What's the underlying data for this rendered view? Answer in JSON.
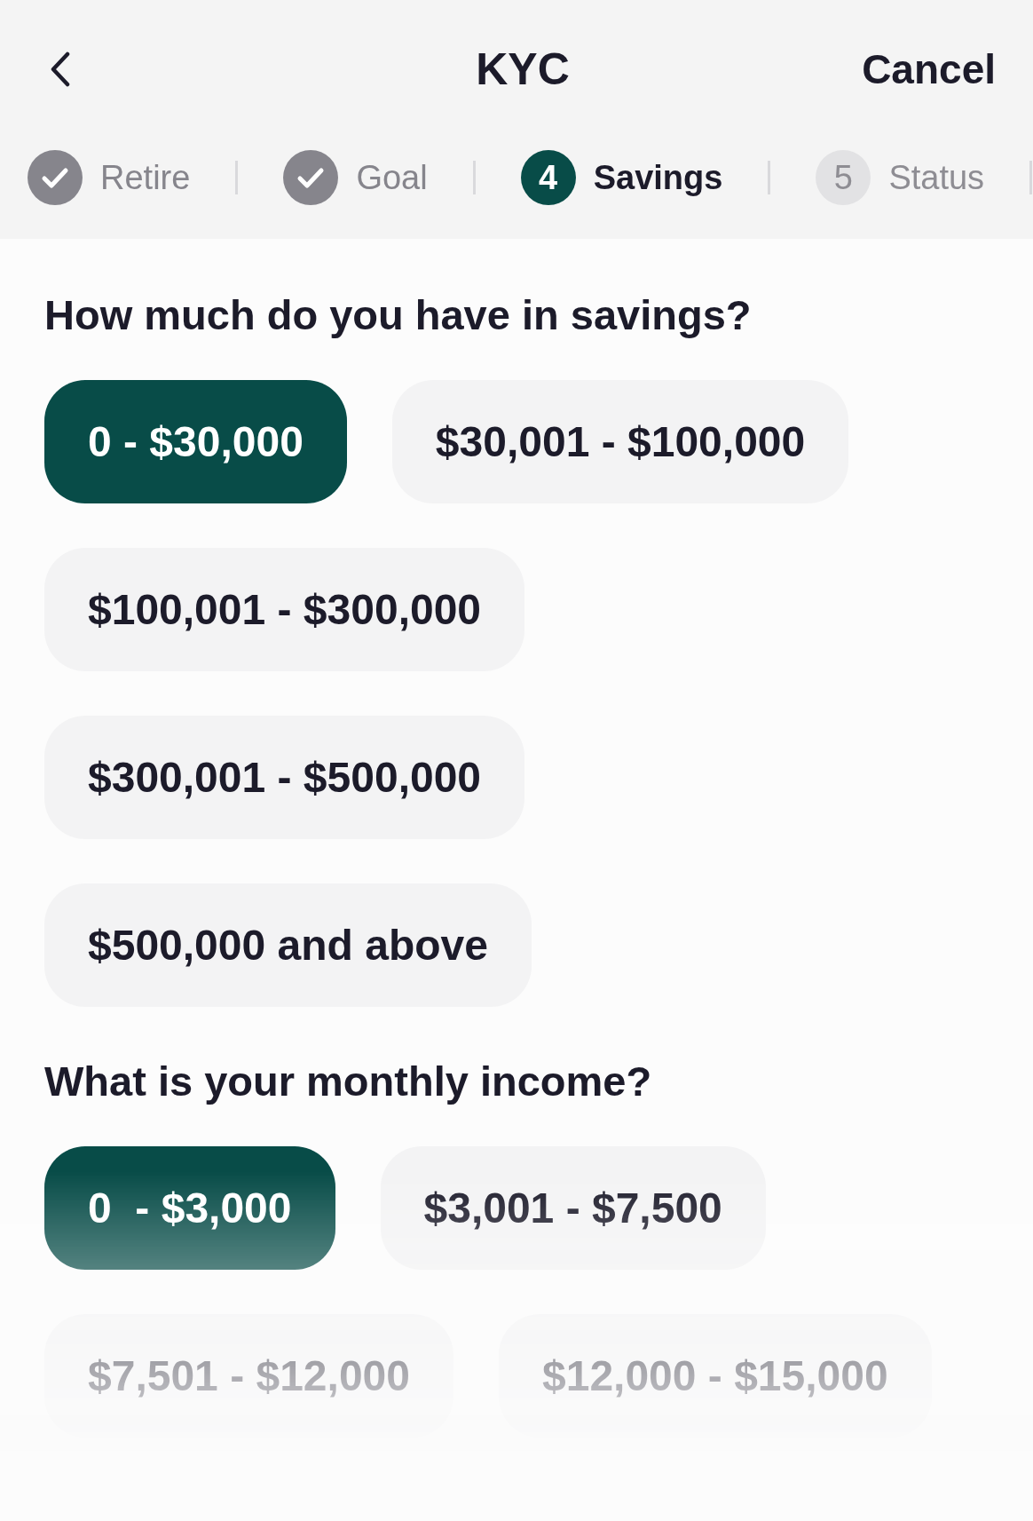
{
  "header": {
    "title": "KYC",
    "cancel": "Cancel"
  },
  "steps": [
    {
      "label": "Retire",
      "completed": true,
      "selected": false
    },
    {
      "label": "Goal",
      "completed": true,
      "selected": false
    },
    {
      "number": "4",
      "label": "Savings",
      "completed": false,
      "selected": true
    },
    {
      "number": "5",
      "label": "Status",
      "completed": false,
      "selected": false
    }
  ],
  "questions": [
    {
      "title": "How much do you have in savings?",
      "options": [
        {
          "label": "0 - $30,000",
          "selected": true
        },
        {
          "label": "$30,001 - $100,000",
          "selected": false
        },
        {
          "label": "$100,001 - $300,000",
          "selected": false
        },
        {
          "label": "$300,001 - $500,000",
          "selected": false
        },
        {
          "label": "$500,000 and above",
          "selected": false
        }
      ]
    },
    {
      "title": "What is your monthly income?",
      "options": [
        {
          "label": "0  - $3,000",
          "selected": true
        },
        {
          "label": "$3,001 - $7,500",
          "selected": false
        },
        {
          "label": "$7,501 - $12,000",
          "selected": false
        },
        {
          "label": "$12,000 - $15,000",
          "selected": false
        }
      ]
    }
  ]
}
